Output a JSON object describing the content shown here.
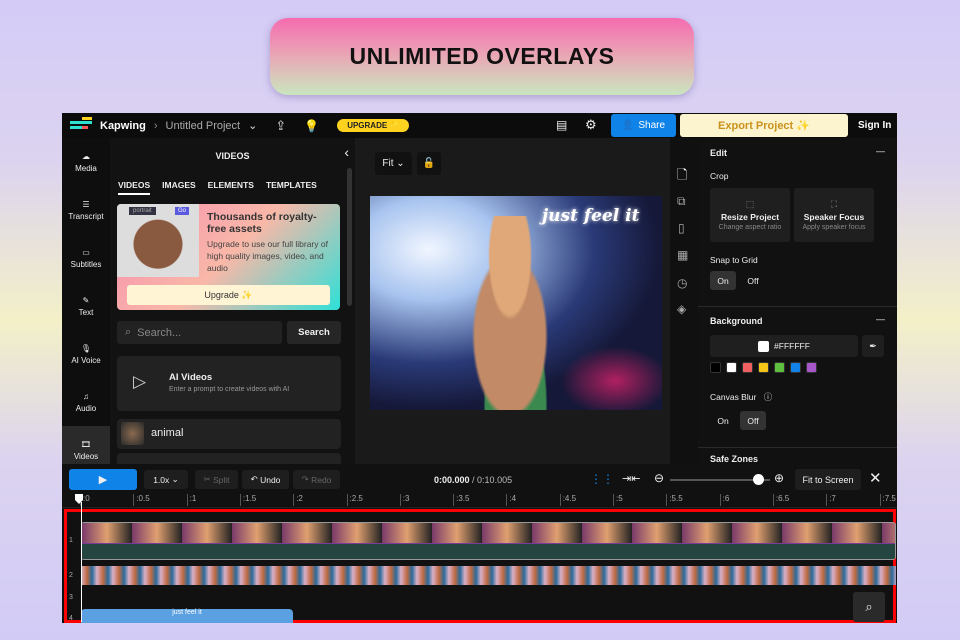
{
  "banner": {
    "title": "UNLIMITED OVERLAYS"
  },
  "topbar": {
    "brand": "Kapwing",
    "project": "Untitled Project",
    "upgrade": "UPGRADE ✨",
    "share": "Share",
    "export": "Export Project ✨",
    "signin": "Sign In"
  },
  "rail": [
    {
      "label": "Media",
      "icon": "upload-cloud-icon"
    },
    {
      "label": "Transcript",
      "icon": "transcript-icon"
    },
    {
      "label": "Subtitles",
      "icon": "subtitles-icon"
    },
    {
      "label": "Text",
      "icon": "text-icon"
    },
    {
      "label": "AI Voice",
      "icon": "mic-icon"
    },
    {
      "label": "Audio",
      "icon": "music-icon"
    },
    {
      "label": "Videos",
      "icon": "film-icon"
    }
  ],
  "panel": {
    "title": "VIDEOS",
    "tabs": [
      "VIDEOS",
      "IMAGES",
      "ELEMENTS",
      "TEMPLATES"
    ],
    "promo": {
      "search_chip": "portrait",
      "go": "Go",
      "heading": "Thousands of royalty-free assets",
      "body": "Upgrade to use our full library of high quality images, video, and audio",
      "button": "Upgrade ✨"
    },
    "search_placeholder": "Search...",
    "search_button": "Search",
    "ai": {
      "title": "AI Videos",
      "subtitle": "Enter a prompt to create videos with AI"
    },
    "results": [
      "animal"
    ]
  },
  "canvas": {
    "fit": "Fit",
    "overlay_text": "just feel it"
  },
  "right": {
    "edit": "Edit",
    "crop": "Crop",
    "resize_title": "Resize Project",
    "resize_sub": "Change aspect ratio",
    "speaker_title": "Speaker Focus",
    "speaker_sub": "Apply speaker focus",
    "snap": "Snap to Grid",
    "on": "On",
    "off": "Off",
    "background": "Background",
    "hex": "#FFFFFF",
    "swatches": [
      "#000000",
      "#ffffff",
      "#f06060",
      "#f5c518",
      "#5fbf3f",
      "#1183e8",
      "#a757c9"
    ],
    "blur": "Canvas Blur",
    "safe": "Safe Zones"
  },
  "timeline": {
    "speed": "1.0x",
    "split": "Split",
    "undo": "Undo",
    "redo": "Redo",
    "time": "0:00.000",
    "duration": "/ 0:10.005",
    "fit": "Fit to Screen",
    "ticks": [
      ":0",
      ":0.5",
      ":1",
      ":1.5",
      ":2",
      ":2.5",
      ":3",
      ":3.5",
      ":4",
      ":4.5",
      ":5",
      ":5.5",
      ":6",
      ":6.5",
      ":7",
      ":7.5"
    ],
    "tracks": [
      "1",
      "2",
      "3",
      "4"
    ],
    "zoom": 0.88
  }
}
